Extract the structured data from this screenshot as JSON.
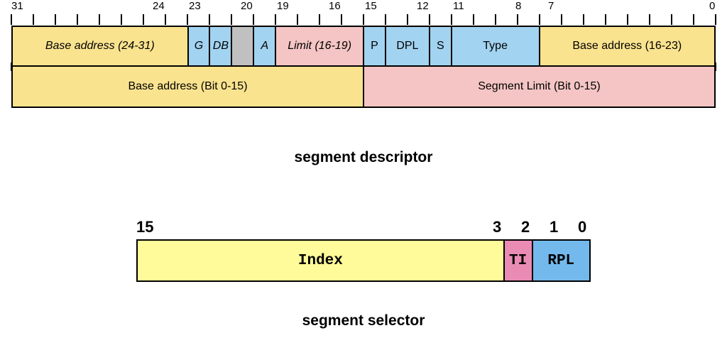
{
  "descriptor": {
    "caption": "segment descriptor",
    "top_numbers": [
      "31",
      "24",
      "23",
      "20",
      "19",
      "16",
      "15",
      "12",
      "11",
      "8",
      "7",
      "0"
    ],
    "row1": {
      "base_24_31": "Base address (24-31)",
      "g": "G",
      "db": "DB",
      "a": "A",
      "limit_16_19": "Limit (16-19)",
      "p": "P",
      "dpl": "DPL",
      "s": "S",
      "type": "Type",
      "base_16_23": "Base address (16-23)"
    },
    "row2": {
      "base_0_15": "Base address (Bit 0-15)",
      "limit_0_15": "Segment Limit (Bit 0-15)"
    }
  },
  "selector": {
    "caption": "segment selector",
    "numbers": {
      "n15": "15",
      "n3": "3",
      "n2": "2",
      "n1": "1",
      "n0": "0"
    },
    "index": "Index",
    "ti": "TI",
    "rpl": "RPL"
  }
}
